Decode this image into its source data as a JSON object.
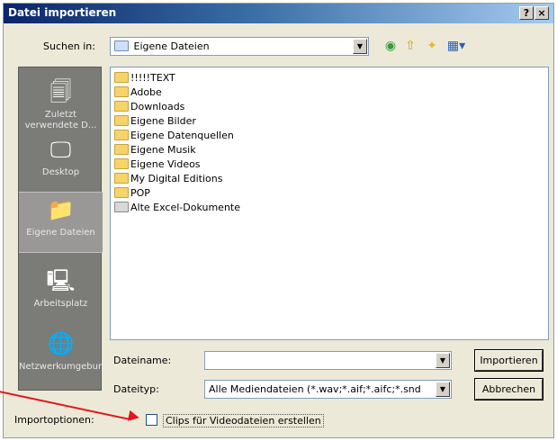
{
  "window": {
    "title": "Datei importieren",
    "help_button": "?",
    "close_button": "×"
  },
  "lookin": {
    "label": "Suchen in:",
    "value": "Eigene Dateien"
  },
  "toolbar": {
    "back_icon": "back-icon",
    "up_icon": "up-folder-icon",
    "new_folder_icon": "new-folder-icon",
    "view_menu_icon": "view-menu-icon"
  },
  "places": [
    {
      "label": "Zuletzt verwendete D...",
      "icon": "recent-docs-icon"
    },
    {
      "label": "Desktop",
      "icon": "desktop-icon"
    },
    {
      "label": "Eigene Dateien",
      "icon": "my-documents-icon"
    },
    {
      "label": "Arbeitsplatz",
      "icon": "my-computer-icon"
    },
    {
      "label": "Netzwerkumgebung",
      "icon": "network-icon"
    }
  ],
  "files": [
    "!!!!!TEXT",
    "Adobe",
    "Downloads",
    "Eigene Bilder",
    "Eigene Datenquellen",
    "Eigene Musik",
    "Eigene Videos",
    "My Digital Editions",
    "POP",
    "Alte Excel-Dokumente"
  ],
  "filename": {
    "label": "Dateiname:",
    "value": ""
  },
  "filetype": {
    "label": "Dateityp:",
    "value": "Alle Mediendateien (*.wav;*.aif;*.aifc;*.snd"
  },
  "buttons": {
    "import": "Importieren",
    "cancel": "Abbrechen"
  },
  "options": {
    "label": "Importoptionen:",
    "checkbox_label": "Clips für Videodateien erstellen",
    "checked": false
  },
  "colors": {
    "titlebar": "#0a246a",
    "annotation_arrow": "#e4151b"
  }
}
